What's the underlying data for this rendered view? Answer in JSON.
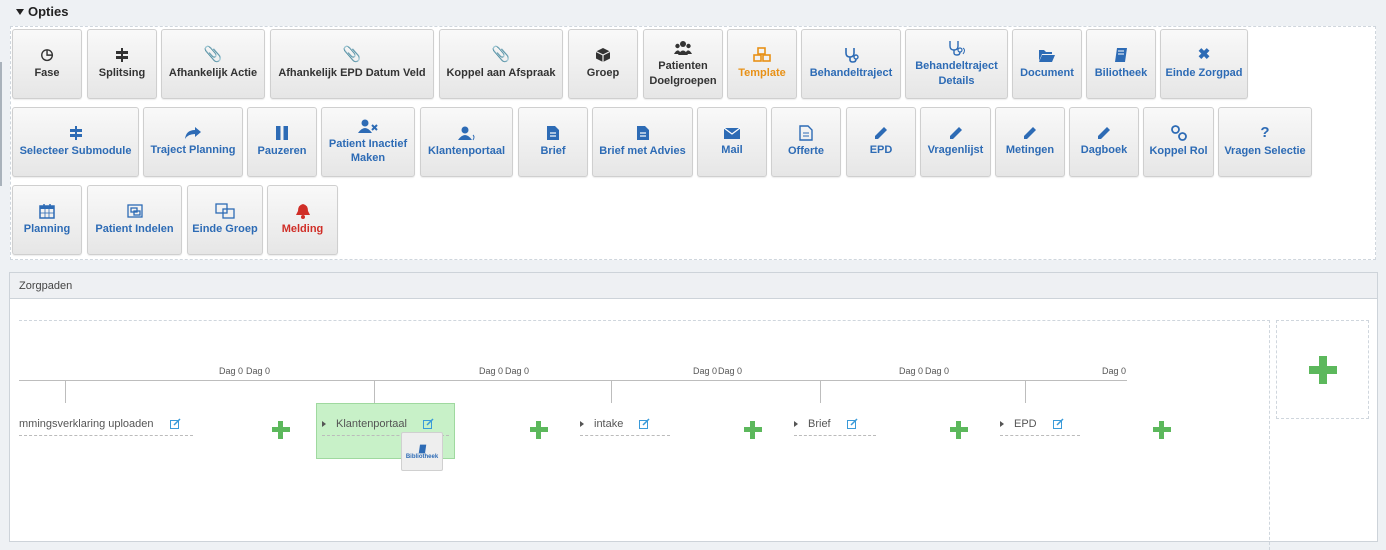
{
  "opties": {
    "title": "Opties",
    "row1": [
      {
        "label": "Fase",
        "icon": "clock-icon"
      },
      {
        "label": "Splitsing",
        "icon": "signpost-icon"
      },
      {
        "label": "Afhankelijk Actie",
        "icon": "paperclip-icon"
      },
      {
        "label": "Afhankelijk EPD Datum Veld",
        "icon": "paperclip-icon"
      },
      {
        "label": "Koppel aan Afspraak",
        "icon": "paperclip-icon"
      },
      {
        "label": "Groep",
        "icon": "cube-icon"
      },
      {
        "label": "Patienten Doelgroepen",
        "icon": "users-icon"
      },
      {
        "label": "Template",
        "icon": "cubes-icon"
      },
      {
        "label": "Behandeltraject",
        "icon": "stethoscope-icon"
      },
      {
        "label": "Behandeltraject Details",
        "icon": "stethoscope-icon"
      },
      {
        "label": "Document",
        "icon": "folder-open-icon"
      },
      {
        "label": "Biliotheek",
        "icon": "book-icon"
      },
      {
        "label": "Einde Zorgpad",
        "icon": "times-icon"
      }
    ],
    "row2": [
      {
        "label": "Selecteer Submodule",
        "icon": "signpost-icon"
      },
      {
        "label": "Traject Planning",
        "icon": "share-icon"
      },
      {
        "label": "Pauzeren",
        "icon": "pause-icon"
      },
      {
        "label": "Patient Inactief Maken",
        "icon": "user-times-icon"
      },
      {
        "label": "Klantenportaal",
        "icon": "user-portal-icon"
      },
      {
        "label": "Brief",
        "icon": "file-text-icon"
      },
      {
        "label": "Brief met Advies",
        "icon": "file-text-icon"
      },
      {
        "label": "Mail",
        "icon": "envelope-icon"
      },
      {
        "label": "Offerte",
        "icon": "file-outline-icon"
      },
      {
        "label": "EPD",
        "icon": "pencil-icon"
      },
      {
        "label": "Vragenlijst",
        "icon": "pencil-icon"
      },
      {
        "label": "Metingen",
        "icon": "pencil-icon"
      },
      {
        "label": "Dagboek",
        "icon": "pencil-icon"
      },
      {
        "label": "Koppel Rol",
        "icon": "link-icon"
      },
      {
        "label": "Vragen Selectie",
        "icon": "question-icon"
      }
    ],
    "row3": [
      {
        "label": "Planning",
        "icon": "calendar-icon"
      },
      {
        "label": "Patient Indelen",
        "icon": "object-group-icon"
      },
      {
        "label": "Einde Groep",
        "icon": "object-ungroup-icon"
      },
      {
        "label": "Melding",
        "icon": "bell-icon"
      }
    ]
  },
  "zorgpaden": {
    "title": "Zorgpaden",
    "day_labels": [
      "Dag 0",
      "Dag 0",
      "Dag 0",
      "Dag 0",
      "Dag 0",
      "Dag 0",
      "Dag 0",
      "Dag 0",
      "Dag 0"
    ],
    "steps": [
      {
        "label": "mmingsverklaring uploaden"
      },
      {
        "label": "Klantenportaal",
        "badge": "Bibliotheek"
      },
      {
        "label": "intake"
      },
      {
        "label": "Brief"
      },
      {
        "label": "EPD"
      }
    ]
  },
  "colors": {
    "blue": "#2d6bb5",
    "orange": "#e89117",
    "red": "#d02e27",
    "green": "#5cb85c",
    "highlight": "#c8f1c8"
  }
}
